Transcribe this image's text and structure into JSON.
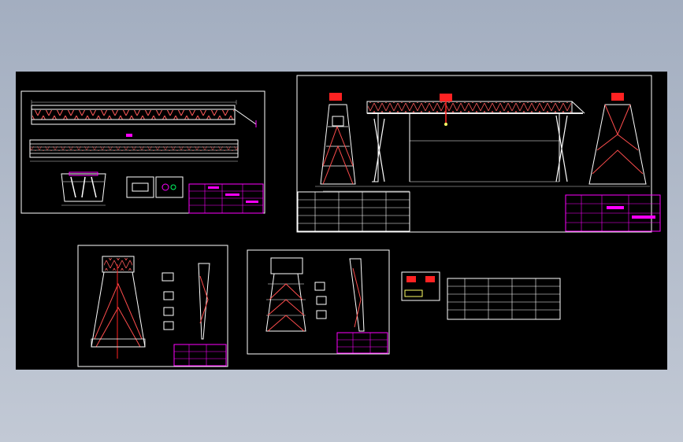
{
  "app": {
    "background_color": "#b4bccb",
    "canvas_color": "#000000"
  },
  "palette": {
    "frame": "#ffffff",
    "truss": "#ff4d4d",
    "titleblock": "#ff00ff",
    "dim": "#cfcfcf",
    "leader": "#00ff66",
    "hoist": "#ff2222",
    "beam_fill": "#e8e8e8",
    "green": "#44ff44",
    "yellow": "#ffff66"
  },
  "sheets": [
    {
      "id": "beam-elevation-sheet"
    },
    {
      "id": "general-assembly-sheet"
    },
    {
      "id": "rigid-leg-sheet"
    },
    {
      "id": "flexible-leg-sheet"
    },
    {
      "id": "trolley-detail-sheet"
    },
    {
      "id": "parameter-table-sheet"
    }
  ]
}
